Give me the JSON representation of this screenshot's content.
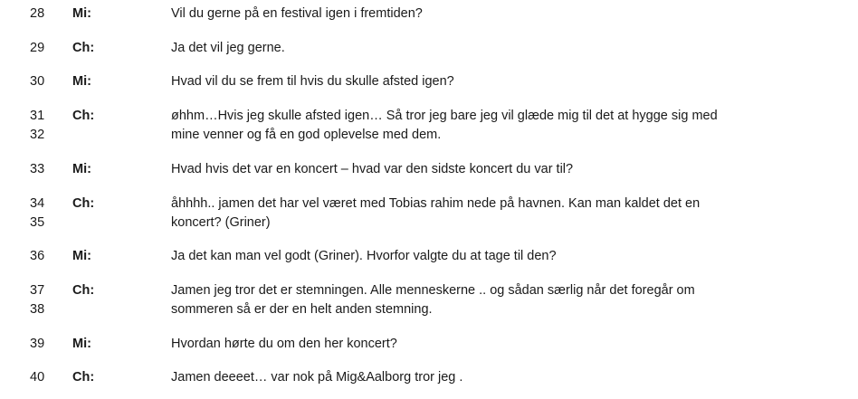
{
  "transcript": [
    {
      "lines": [
        "28"
      ],
      "speaker": "Mi:",
      "text": [
        "Vil du gerne på en festival igen i fremtiden?"
      ]
    },
    {
      "lines": [
        "29"
      ],
      "speaker": "Ch:",
      "text": [
        "Ja det vil jeg gerne."
      ]
    },
    {
      "lines": [
        "30"
      ],
      "speaker": "Mi:",
      "text": [
        "Hvad vil du se frem til hvis du skulle afsted igen?"
      ]
    },
    {
      "lines": [
        "31",
        "32"
      ],
      "speaker": "Ch:",
      "text": [
        "øhhm…Hvis jeg skulle afsted igen… Så tror jeg bare jeg vil glæde mig til det at hygge sig med",
        "mine venner og få en god oplevelse med dem."
      ]
    },
    {
      "lines": [
        "33"
      ],
      "speaker": "Mi:",
      "text": [
        "Hvad hvis det var en koncert – hvad var den sidste koncert du var til?"
      ]
    },
    {
      "lines": [
        "34",
        "35"
      ],
      "speaker": "Ch:",
      "text": [
        "åhhhh.. jamen det har vel været med Tobias rahim nede på havnen. Kan man kaldet det en",
        "koncert? (Griner)"
      ]
    },
    {
      "lines": [
        "36"
      ],
      "speaker": "Mi:",
      "text": [
        "Ja det kan man vel godt (Griner). Hvorfor valgte du at tage til den?"
      ]
    },
    {
      "lines": [
        "37",
        "38"
      ],
      "speaker": "Ch:",
      "text": [
        "Jamen jeg tror det er stemningen. Alle menneskerne .. og sådan særlig når det foregår om",
        "sommeren så er der en helt anden stemning."
      ]
    },
    {
      "lines": [
        "39"
      ],
      "speaker": "Mi:",
      "text": [
        "Hvordan hørte du om den her koncert?"
      ]
    },
    {
      "lines": [
        "40"
      ],
      "speaker": "Ch:",
      "text": [
        "Jamen deeeet… var nok på Mig&Aalborg tror jeg ."
      ]
    }
  ]
}
